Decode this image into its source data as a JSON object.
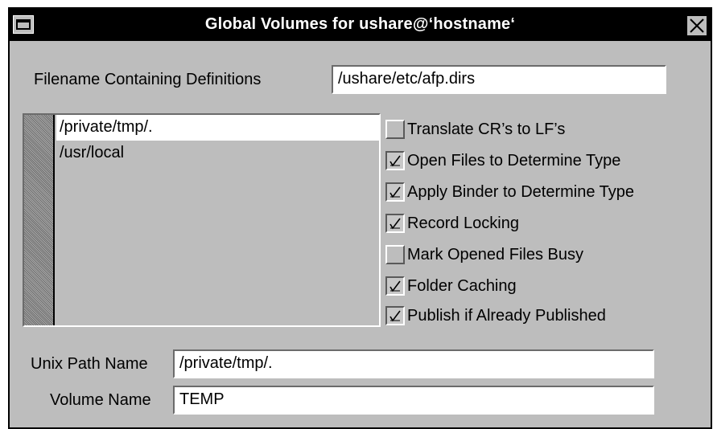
{
  "window": {
    "title": "Global Volumes for ushare@‘hostname‘"
  },
  "definitions": {
    "label": "Filename Containing Definitions",
    "value": "/ushare/etc/afp.dirs"
  },
  "volume_list": {
    "items": [
      "/private/tmp/.",
      "/usr/local"
    ],
    "selected_index": 0
  },
  "options": [
    {
      "label": "Translate CR’s to LF’s",
      "checked": false
    },
    {
      "label": "Open Files to Determine Type",
      "checked": true
    },
    {
      "label": "Apply Binder to Determine Type",
      "checked": true
    },
    {
      "label": "Record Locking",
      "checked": true
    },
    {
      "label": "Mark Opened Files Busy",
      "checked": false
    },
    {
      "label": "Folder Caching",
      "checked": true
    },
    {
      "label": "Publish if Already Published",
      "checked": true
    }
  ],
  "unix_path": {
    "label": "Unix Path Name",
    "value": "/private/tmp/."
  },
  "volume_name": {
    "label": "Volume Name",
    "value": "TEMP"
  }
}
